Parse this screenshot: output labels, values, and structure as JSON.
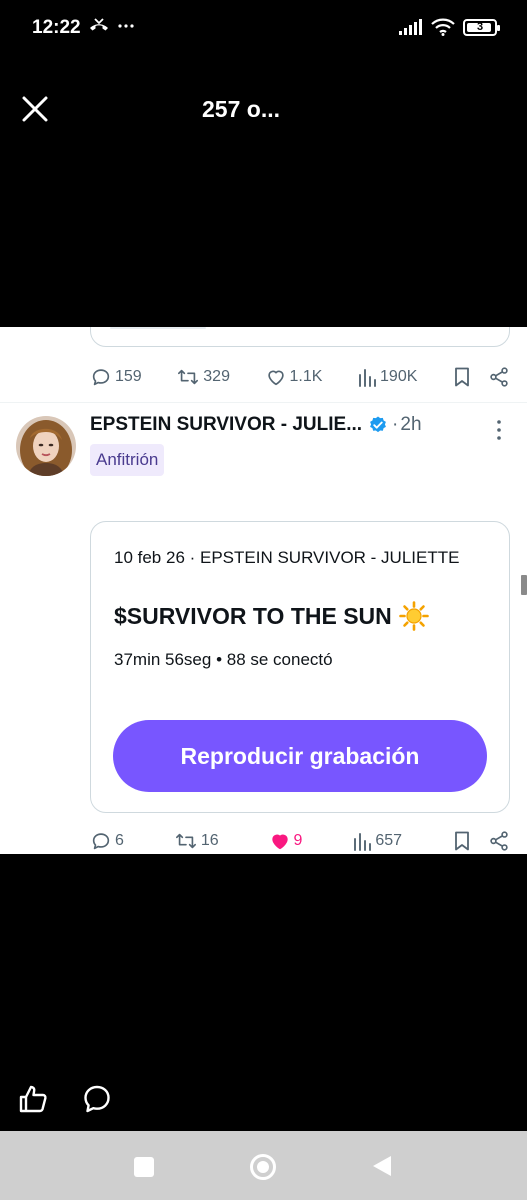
{
  "status_bar": {
    "time": "12:22",
    "battery_level": "3",
    "icons": [
      "missed-call-icon",
      "more-dots-icon",
      "signal-icon",
      "wifi-icon",
      "battery-icon"
    ]
  },
  "header": {
    "title": "257 o...",
    "close_icon": "close-icon"
  },
  "previous_tweet": {
    "replies": "159",
    "retweets": "329",
    "likes": "1.1K",
    "views": "190K"
  },
  "tweet": {
    "author_name": "EPSTEIN SURVIVOR - JULIE...",
    "time_ago": "2h",
    "separator": "·",
    "host_badge": "Anfitrión",
    "verified_color": "#1d9bf0",
    "space": {
      "meta": "10 feb 26 · EPSTEIN SURVIVOR - JULIETTE",
      "title": "$SURVIVOR TO THE SUN",
      "title_emoji": "☀️",
      "stats": "37min 56seg • 88 se conectó",
      "play_button": "Reproducir grabación",
      "accent_color": "#7856ff"
    },
    "replies": "6",
    "retweets": "16",
    "likes": "9",
    "views": "657",
    "liked": true,
    "like_color": "#f91880"
  },
  "bottom_actions": {
    "icons": [
      "like-icon",
      "comment-icon"
    ]
  },
  "nav_bar": {
    "buttons": [
      "recents-button",
      "home-button",
      "back-button"
    ]
  }
}
